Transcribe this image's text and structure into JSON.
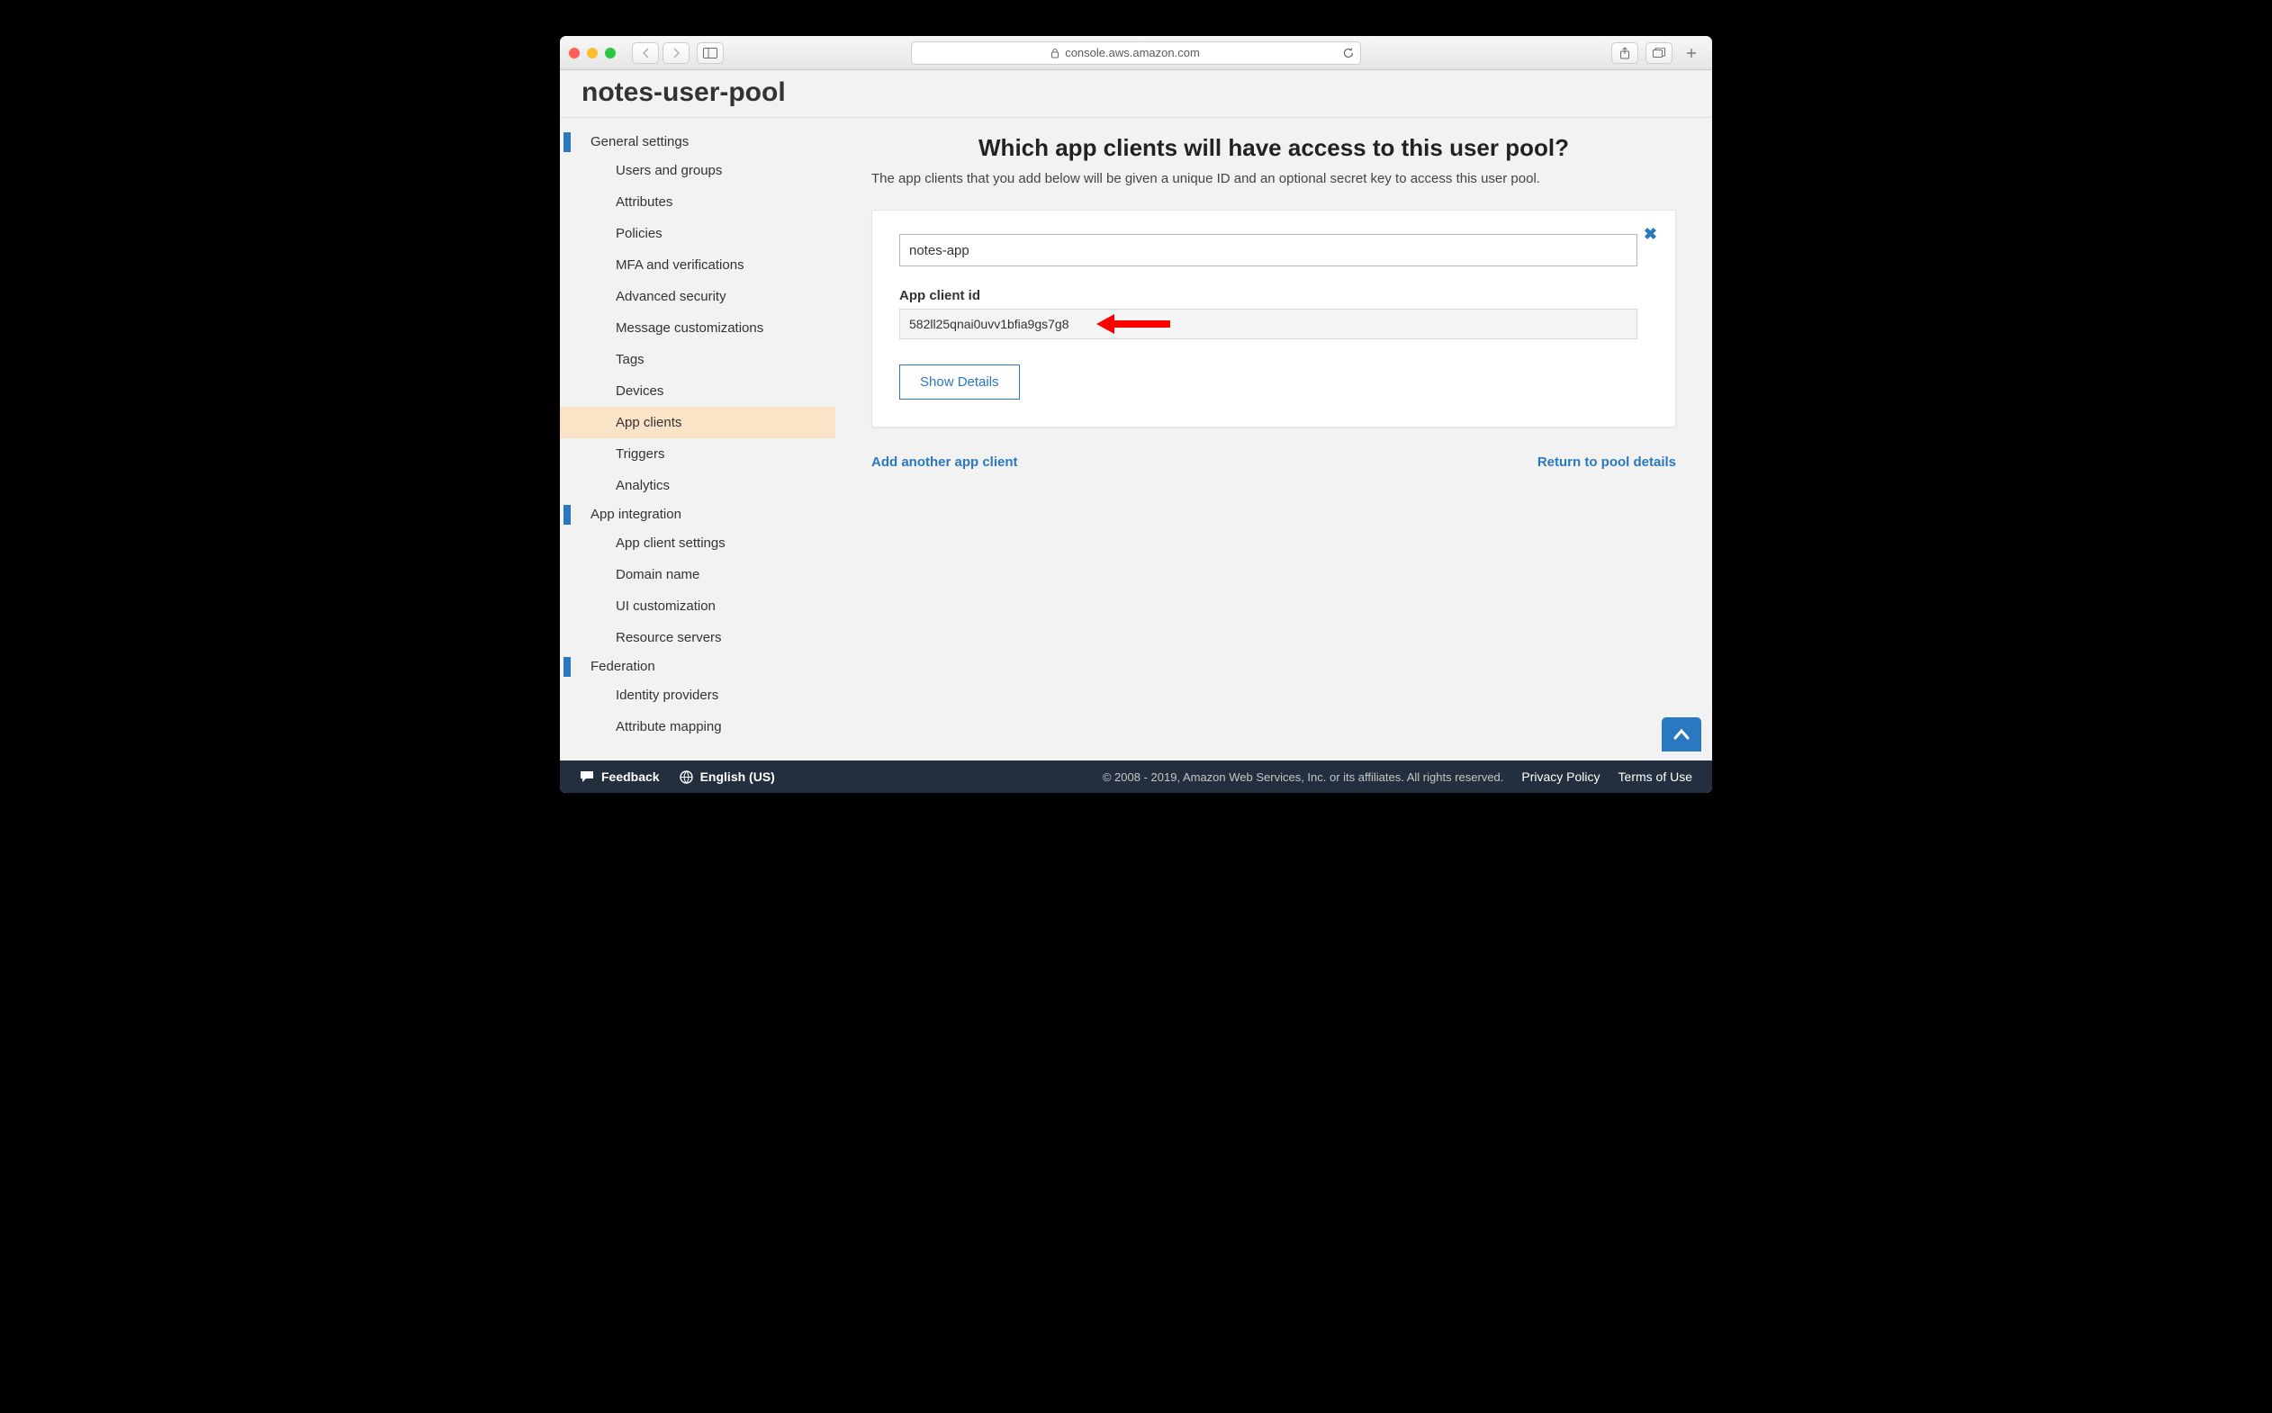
{
  "chrome": {
    "address": "console.aws.amazon.com"
  },
  "header": {
    "pool_title": "notes-user-pool"
  },
  "sidebar": {
    "sections": [
      {
        "label": "General settings",
        "items": [
          {
            "label": "Users and groups"
          },
          {
            "label": "Attributes"
          },
          {
            "label": "Policies"
          },
          {
            "label": "MFA and verifications"
          },
          {
            "label": "Advanced security"
          },
          {
            "label": "Message customizations"
          },
          {
            "label": "Tags"
          },
          {
            "label": "Devices"
          },
          {
            "label": "App clients",
            "active": true
          },
          {
            "label": "Triggers"
          },
          {
            "label": "Analytics"
          }
        ]
      },
      {
        "label": "App integration",
        "items": [
          {
            "label": "App client settings"
          },
          {
            "label": "Domain name"
          },
          {
            "label": "UI customization"
          },
          {
            "label": "Resource servers"
          }
        ]
      },
      {
        "label": "Federation",
        "items": [
          {
            "label": "Identity providers"
          },
          {
            "label": "Attribute mapping"
          }
        ]
      }
    ]
  },
  "main": {
    "heading": "Which app clients will have access to this user pool?",
    "subtext": "The app clients that you add below will be given a unique ID and an optional secret key to access this user pool.",
    "card": {
      "app_name": "notes-app",
      "app_client_id_label": "App client id",
      "app_client_id": "582ll25qnai0uvv1bfia9gs7g8",
      "show_details": "Show Details"
    },
    "add_another": "Add another app client",
    "return_link": "Return to pool details"
  },
  "footer": {
    "feedback": "Feedback",
    "language": "English (US)",
    "copyright": "© 2008 - 2019, Amazon Web Services, Inc. or its affiliates. All rights reserved.",
    "privacy": "Privacy Policy",
    "terms": "Terms of Use"
  }
}
